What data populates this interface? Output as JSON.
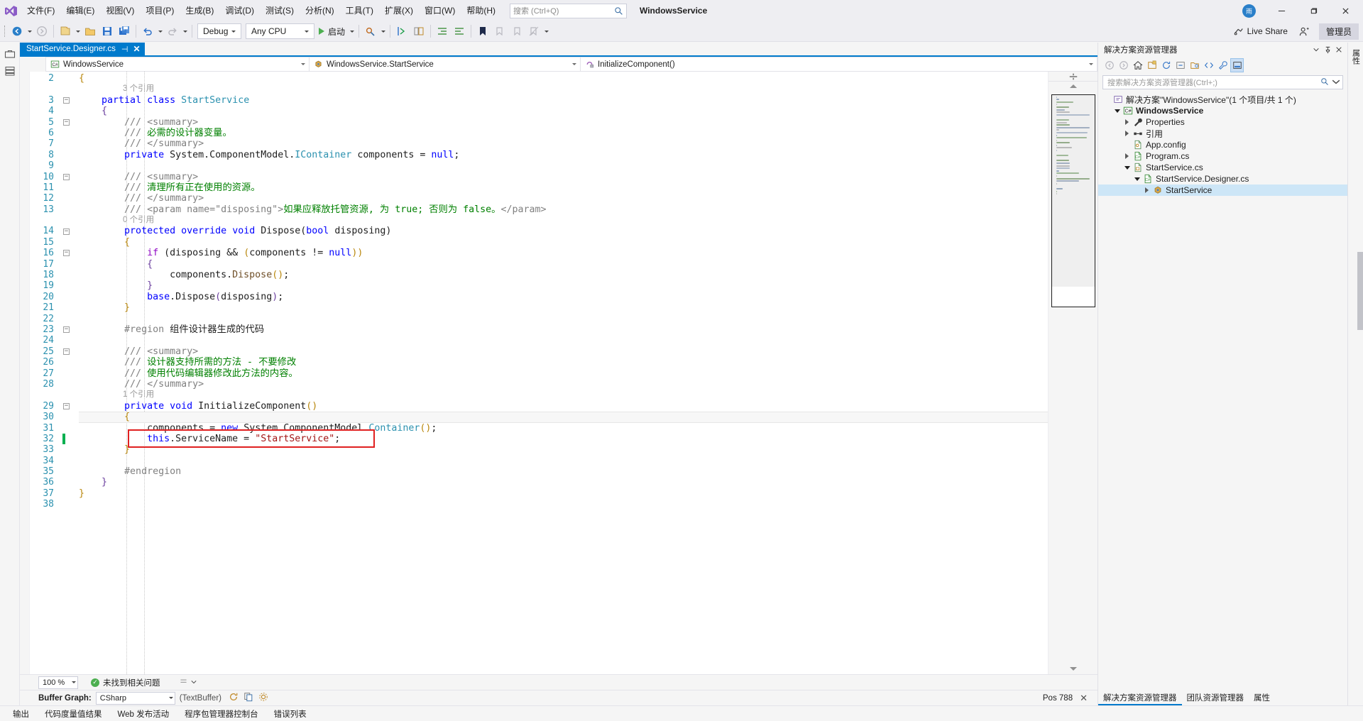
{
  "titlebar": {
    "menus": [
      {
        "label": "文件(F)",
        "name": "menu-file"
      },
      {
        "label": "编辑(E)",
        "name": "menu-edit"
      },
      {
        "label": "视图(V)",
        "name": "menu-view"
      },
      {
        "label": "项目(P)",
        "name": "menu-project"
      },
      {
        "label": "生成(B)",
        "name": "menu-build"
      },
      {
        "label": "调试(D)",
        "name": "menu-debug"
      },
      {
        "label": "测试(S)",
        "name": "menu-test"
      },
      {
        "label": "分析(N)",
        "name": "menu-analyze"
      },
      {
        "label": "工具(T)",
        "name": "menu-tools"
      },
      {
        "label": "扩展(X)",
        "name": "menu-extensions"
      },
      {
        "label": "窗口(W)",
        "name": "menu-window"
      },
      {
        "label": "帮助(H)",
        "name": "menu-help"
      }
    ],
    "search_placeholder": "搜索 (Ctrl+Q)",
    "app_title": "WindowsService",
    "avatar_initial": "雨",
    "minimize": "–",
    "maximize": "□",
    "close": "✕"
  },
  "toolbar": {
    "config_value": "Debug",
    "platform_value": "Any CPU",
    "run_label": "启动",
    "live_share_label": "Live Share",
    "admin_label": "管理员"
  },
  "editor": {
    "tab_title": "StartService.Designer.cs",
    "tab_pin": "⌐",
    "tab_close": "✕",
    "breadcrumb": {
      "project": "WindowsService",
      "class": "WindowsService.StartService",
      "member": "InitializeComponent()"
    },
    "zoom_level": "100 %",
    "issue_status": "未找到相关问题",
    "buffer_graph_label": "Buffer Graph:",
    "buffer_value": "CSharp",
    "buffer_suffix": "(TextBuffer)",
    "position": "Pos 788",
    "code_lines": [
      {
        "num": "2",
        "fold": "",
        "html": "<span class='cl-brace2'>{</span>",
        "indent": 0
      },
      {
        "num": "",
        "fold": "",
        "lens": "3 个引用"
      },
      {
        "num": "3",
        "fold": "-",
        "html": "    <span class='cl-kw'>partial</span> <span class='cl-kw'>class</span> <span class='cl-type'>StartService</span>"
      },
      {
        "num": "4",
        "fold": "",
        "html": "    <span class='cl-brace'>{</span>"
      },
      {
        "num": "5",
        "fold": "-",
        "html": "        <span class='cl-cmtx'>/// &lt;summary&gt;</span>"
      },
      {
        "num": "6",
        "fold": "",
        "html": "        <span class='cl-cmtx'>/// </span><span class='cl-cmt'>必需的设计器变量。</span>"
      },
      {
        "num": "7",
        "fold": "",
        "html": "        <span class='cl-cmtx'>/// &lt;/summary&gt;</span>"
      },
      {
        "num": "8",
        "fold": "",
        "html": "        <span class='cl-kw'>private</span> <span class='cl-plain'>System.ComponentModel.</span><span class='cl-type'>IContainer</span> <span class='cl-plain'>components = </span><span class='cl-kw'>null</span><span class='cl-plain'>;</span>"
      },
      {
        "num": "9",
        "fold": "",
        "html": ""
      },
      {
        "num": "10",
        "fold": "-",
        "html": "        <span class='cl-cmtx'>/// &lt;summary&gt;</span>"
      },
      {
        "num": "11",
        "fold": "",
        "html": "        <span class='cl-cmtx'>/// </span><span class='cl-cmt'>清理所有正在使用的资源。</span>"
      },
      {
        "num": "12",
        "fold": "",
        "html": "        <span class='cl-cmtx'>/// &lt;/summary&gt;</span>"
      },
      {
        "num": "13",
        "fold": "",
        "html": "        <span class='cl-cmtx'>/// &lt;param name=\"disposing\"&gt;</span><span class='cl-cmt'>如果应释放托管资源, 为 true; 否则为 false。</span><span class='cl-cmtx'>&lt;/param&gt;</span>"
      },
      {
        "num": "",
        "fold": "",
        "lens": "0 个引用"
      },
      {
        "num": "14",
        "fold": "-",
        "html": "        <span class='cl-kw'>protected</span> <span class='cl-kw'>override</span> <span class='cl-kw'>void</span> <span class='cl-plain'>Dispose(</span><span class='cl-kw'>bool</span> <span class='cl-plain'>disposing)</span>"
      },
      {
        "num": "15",
        "fold": "",
        "html": "        <span class='cl-brace2'>{</span>"
      },
      {
        "num": "16",
        "fold": "-",
        "html": "            <span class='cl-kw' style='color:#8f08c4'>if</span> <span class='cl-plain'>(disposing &amp;&amp; </span><span class='cl-brace2'>(</span><span class='cl-plain'>components != </span><span class='cl-kw'>null</span><span class='cl-brace2'>))</span>"
      },
      {
        "num": "17",
        "fold": "",
        "html": "            <span class='cl-brace'>{</span>"
      },
      {
        "num": "18",
        "fold": "",
        "html": "                <span class='cl-plain'>components.</span><span class='cl-plain' style='color:#6f4f28'>Dispose</span><span class='cl-brace2'>()</span><span class='cl-plain'>;</span>"
      },
      {
        "num": "19",
        "fold": "",
        "html": "            <span class='cl-brace'>}</span>"
      },
      {
        "num": "20",
        "fold": "",
        "html": "            <span class='cl-kw'>base</span><span class='cl-plain'>.Dispose</span><span class='cl-brace'>(</span><span class='cl-plain'>disposing</span><span class='cl-brace'>)</span><span class='cl-plain'>;</span>"
      },
      {
        "num": "21",
        "fold": "",
        "html": "        <span class='cl-brace2'>}</span>"
      },
      {
        "num": "22",
        "fold": "",
        "html": ""
      },
      {
        "num": "23",
        "fold": "-",
        "html": "        <span class='cl-region'>#region</span> <span class='cl-regiontext'>组件设计器生成的代码</span>"
      },
      {
        "num": "24",
        "fold": "",
        "html": ""
      },
      {
        "num": "25",
        "fold": "-",
        "html": "        <span class='cl-cmtx'>/// &lt;summary&gt;</span>"
      },
      {
        "num": "26",
        "fold": "",
        "html": "        <span class='cl-cmtx'>/// </span><span class='cl-cmt'>设计器支持所需的方法 - 不要修改</span>"
      },
      {
        "num": "27",
        "fold": "",
        "html": "        <span class='cl-cmtx'>/// </span><span class='cl-cmt'>使用代码编辑器修改此方法的内容。</span>"
      },
      {
        "num": "28",
        "fold": "",
        "html": "        <span class='cl-cmtx'>/// &lt;/summary&gt;</span>"
      },
      {
        "num": "",
        "fold": "",
        "lens": "1 个引用"
      },
      {
        "num": "29",
        "fold": "-",
        "html": "        <span class='cl-kw'>private</span> <span class='cl-kw'>void</span> <span class='cl-plain'>InitializeComponent</span><span class='cl-brace2'>()</span>"
      },
      {
        "num": "30",
        "fold": "",
        "html": "        <span class='cl-brace2'>{</span>",
        "current": true
      },
      {
        "num": "31",
        "fold": "",
        "html": "            <span class='cl-plain'>components = </span><span class='cl-kw'>new</span> <span class='cl-plain'>System.ComponentModel.</span><span class='cl-type'>Container</span><span class='cl-brace2'>()</span><span class='cl-plain'>;</span>"
      },
      {
        "num": "32",
        "fold": "",
        "html": "            <span class='cl-kw'>this</span><span class='cl-plain'>.ServiceName = </span><span class='cl-str'>\"StartService\"</span><span class='cl-plain'>;</span>",
        "changed": true
      },
      {
        "num": "33",
        "fold": "",
        "html": "        <span class='cl-brace2'>}</span>"
      },
      {
        "num": "34",
        "fold": "",
        "html": ""
      },
      {
        "num": "35",
        "fold": "",
        "html": "        <span class='cl-region'>#endregion</span>"
      },
      {
        "num": "36",
        "fold": "",
        "html": "    <span class='cl-brace'>}</span>"
      },
      {
        "num": "37",
        "fold": "",
        "html": "<span class='cl-brace2'>}</span>"
      },
      {
        "num": "38",
        "fold": "",
        "html": ""
      }
    ]
  },
  "solution_explorer": {
    "title": "解决方案资源管理器",
    "search_placeholder": "搜索解决方案资源管理器(Ctrl+;)",
    "tree": [
      {
        "label": "解决方案\"WindowsService\"(1 个项目/共 1 个)",
        "icon": "solution-icon",
        "depth": 0,
        "arrow": "none",
        "bold": false
      },
      {
        "label": "WindowsService",
        "icon": "csproj-icon",
        "depth": 1,
        "arrow": "expanded",
        "bold": true
      },
      {
        "label": "Properties",
        "icon": "wrench-icon",
        "depth": 2,
        "arrow": "collapsed",
        "bold": false
      },
      {
        "label": "引用",
        "icon": "references-icon",
        "depth": 2,
        "arrow": "collapsed",
        "bold": false
      },
      {
        "label": "App.config",
        "icon": "config-icon",
        "depth": 2,
        "arrow": "none",
        "bold": false
      },
      {
        "label": "Program.cs",
        "icon": "cs-icon",
        "depth": 2,
        "arrow": "collapsed",
        "bold": false
      },
      {
        "label": "StartService.cs",
        "icon": "csfile-icon",
        "depth": 2,
        "arrow": "expanded",
        "bold": false
      },
      {
        "label": "StartService.Designer.cs",
        "icon": "cs-icon",
        "depth": 3,
        "arrow": "expanded",
        "bold": false
      },
      {
        "label": "StartService",
        "icon": "class-icon",
        "depth": 4,
        "arrow": "collapsed",
        "bold": false,
        "selected": true
      }
    ],
    "footer_tabs": [
      {
        "label": "解决方案资源管理器",
        "active": true
      },
      {
        "label": "团队资源管理器",
        "active": false
      },
      {
        "label": "属性",
        "active": false
      }
    ]
  },
  "statusbar": {
    "items": [
      "输出",
      "代码度量值结果",
      "Web 发布活动",
      "程序包管理器控制台",
      "错误列表"
    ]
  },
  "left_rail": {
    "items": [
      "工具箱",
      "服务器资源管理器"
    ]
  },
  "right_rail": {
    "items": [
      "属性"
    ]
  },
  "colors": {
    "accent": "#007acc",
    "annotation_red": "#e02020",
    "change_green": "#00b050",
    "selection_blue": "#cde6f7"
  }
}
